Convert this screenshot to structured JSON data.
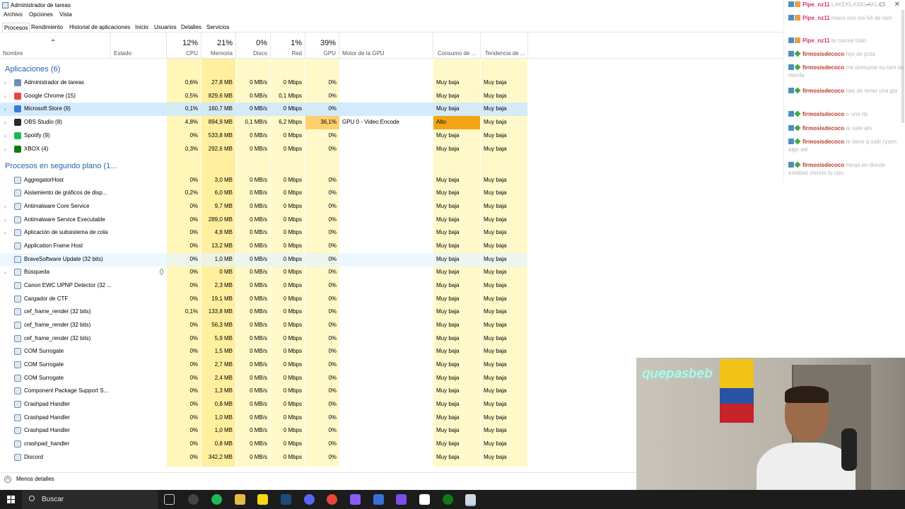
{
  "window": {
    "title": "Administrador de tareas"
  },
  "menu": [
    "Archivo",
    "Opciones",
    "Vista"
  ],
  "tabs": [
    "Procesos",
    "Rendimiento",
    "Historial de aplicaciones",
    "Inicio",
    "Usuarios",
    "Detalles",
    "Servicios"
  ],
  "columns": {
    "nombre": "Nombre",
    "estado": "Estado",
    "cpu_pct": "12%",
    "cpu": "CPU",
    "mem_pct": "21%",
    "mem": "Memoria",
    "disk_pct": "0%",
    "disk": "Disco",
    "net_pct": "1%",
    "net": "Red",
    "gpu_pct": "39%",
    "gpu": "GPU",
    "gpu_engine": "Motor de la GPU",
    "power": "Consumo de ...",
    "power_trend": "Tendencia de ..."
  },
  "groups": {
    "apps": "Aplicaciones (6)",
    "background": "Procesos en segundo plano (1..."
  },
  "apps": [
    {
      "name": "Administrador de tareas",
      "cpu": "0,6%",
      "mem": "27,8 MB",
      "disk": "0 MB/s",
      "net": "0 Mbps",
      "gpu": "0%",
      "engine": "",
      "power": "Muy baja",
      "trend": "Muy baja",
      "icon": "task-manager-icon",
      "color": "#6b8fb5"
    },
    {
      "name": "Google Chrome (15)",
      "cpu": "0,5%",
      "mem": "829,6 MB",
      "disk": "0 MB/s",
      "net": "0,1 Mbps",
      "gpu": "0%",
      "engine": "",
      "power": "Muy baja",
      "trend": "Muy baja",
      "icon": "chrome-icon",
      "color": "#e8453c"
    },
    {
      "name": "Microsoft Store (9)",
      "cpu": "0,1%",
      "mem": "160,7 MB",
      "disk": "0 MB/s",
      "net": "0 Mbps",
      "gpu": "0%",
      "engine": "",
      "power": "Muy baja",
      "trend": "Muy baja",
      "icon": "store-icon",
      "color": "#3a7bd5"
    },
    {
      "name": "OBS Studio (8)",
      "cpu": "4,8%",
      "mem": "894,9 MB",
      "disk": "0,1 MB/s",
      "net": "6,2 Mbps",
      "gpu": "36,1%",
      "engine": "GPU 0 - Video Encode",
      "power": "Alto",
      "trend": "Muy baja",
      "icon": "obs-icon",
      "color": "#2b2b2b"
    },
    {
      "name": "Spotify (9)",
      "cpu": "0%",
      "mem": "533,8 MB",
      "disk": "0 MB/s",
      "net": "0 Mbps",
      "gpu": "0%",
      "engine": "",
      "power": "Muy baja",
      "trend": "Muy baja",
      "icon": "spotify-icon",
      "color": "#1db954"
    },
    {
      "name": "XBOX (4)",
      "cpu": "0,3%",
      "mem": "292,6 MB",
      "disk": "0 MB/s",
      "net": "0 Mbps",
      "gpu": "0%",
      "engine": "",
      "power": "Muy baja",
      "trend": "Muy baja",
      "icon": "xbox-icon",
      "color": "#107c10"
    }
  ],
  "background": [
    {
      "name": "AggregatorHost",
      "cpu": "0%",
      "mem": "3,0 MB",
      "disk": "0 MB/s",
      "net": "0 Mbps",
      "gpu": "0%",
      "power": "Muy baja",
      "trend": "Muy baja",
      "icon": "process-icon"
    },
    {
      "name": "Aislamiento de gráficos de disp...",
      "cpu": "0,2%",
      "mem": "6,0 MB",
      "disk": "0 MB/s",
      "net": "0 Mbps",
      "gpu": "0%",
      "power": "Muy baja",
      "trend": "Muy baja",
      "icon": "process-icon"
    },
    {
      "name": "Antimalware Core Service",
      "cpu": "0%",
      "mem": "9,7 MB",
      "disk": "0 MB/s",
      "net": "0 Mbps",
      "gpu": "0%",
      "power": "Muy baja",
      "trend": "Muy baja",
      "icon": "process-icon"
    },
    {
      "name": "Antimalware Service Executable",
      "cpu": "0%",
      "mem": "289,0 MB",
      "disk": "0 MB/s",
      "net": "0 Mbps",
      "gpu": "0%",
      "power": "Muy baja",
      "trend": "Muy baja",
      "icon": "process-icon"
    },
    {
      "name": "Aplicación de subsistema de cola",
      "cpu": "0%",
      "mem": "4,8 MB",
      "disk": "0 MB/s",
      "net": "0 Mbps",
      "gpu": "0%",
      "power": "Muy baja",
      "trend": "Muy baja",
      "icon": "printer-icon"
    },
    {
      "name": "Application Frame Host",
      "cpu": "0%",
      "mem": "13,2 MB",
      "disk": "0 MB/s",
      "net": "0 Mbps",
      "gpu": "0%",
      "power": "Muy baja",
      "trend": "Muy baja",
      "icon": "process-icon"
    },
    {
      "name": "BraveSoftware Update (32 bits)",
      "cpu": "0%",
      "mem": "1,0 MB",
      "disk": "0 MB/s",
      "net": "0 Mbps",
      "gpu": "0%",
      "power": "Muy baja",
      "trend": "Muy baja",
      "icon": "process-icon"
    },
    {
      "name": "Búsqueda",
      "cpu": "0%",
      "mem": "0 MB",
      "disk": "0 MB/s",
      "net": "0 Mbps",
      "gpu": "0%",
      "power": "Muy baja",
      "trend": "Muy baja",
      "icon": "search-app-icon"
    },
    {
      "name": "Canon EWC UPNP Detector (32 ...",
      "cpu": "0%",
      "mem": "2,3 MB",
      "disk": "0 MB/s",
      "net": "0 Mbps",
      "gpu": "0%",
      "power": "Muy baja",
      "trend": "Muy baja",
      "icon": "process-icon"
    },
    {
      "name": "Cargador de CTF",
      "cpu": "0%",
      "mem": "19,1 MB",
      "disk": "0 MB/s",
      "net": "0 Mbps",
      "gpu": "0%",
      "power": "Muy baja",
      "trend": "Muy baja",
      "icon": "ctf-icon"
    },
    {
      "name": "cef_frame_render (32 bits)",
      "cpu": "0,1%",
      "mem": "133,8 MB",
      "disk": "0 MB/s",
      "net": "0 Mbps",
      "gpu": "0%",
      "power": "Muy baja",
      "trend": "Muy baja",
      "icon": "process-icon"
    },
    {
      "name": "cef_frame_render (32 bits)",
      "cpu": "0%",
      "mem": "56,3 MB",
      "disk": "0 MB/s",
      "net": "0 Mbps",
      "gpu": "0%",
      "power": "Muy baja",
      "trend": "Muy baja",
      "icon": "process-icon"
    },
    {
      "name": "cef_frame_render (32 bits)",
      "cpu": "0%",
      "mem": "5,9 MB",
      "disk": "0 MB/s",
      "net": "0 Mbps",
      "gpu": "0%",
      "power": "Muy baja",
      "trend": "Muy baja",
      "icon": "process-icon"
    },
    {
      "name": "COM Surrogate",
      "cpu": "0%",
      "mem": "1,5 MB",
      "disk": "0 MB/s",
      "net": "0 Mbps",
      "gpu": "0%",
      "power": "Muy baja",
      "trend": "Muy baja",
      "icon": "process-icon"
    },
    {
      "name": "COM Surrogate",
      "cpu": "0%",
      "mem": "2,7 MB",
      "disk": "0 MB/s",
      "net": "0 Mbps",
      "gpu": "0%",
      "power": "Muy baja",
      "trend": "Muy baja",
      "icon": "process-icon"
    },
    {
      "name": "COM Surrogate",
      "cpu": "0%",
      "mem": "2,4 MB",
      "disk": "0 MB/s",
      "net": "0 Mbps",
      "gpu": "0%",
      "power": "Muy baja",
      "trend": "Muy baja",
      "icon": "process-icon"
    },
    {
      "name": "Component Package Support S...",
      "cpu": "0%",
      "mem": "1,3 MB",
      "disk": "0 MB/s",
      "net": "0 Mbps",
      "gpu": "0%",
      "power": "Muy baja",
      "trend": "Muy baja",
      "icon": "process-icon"
    },
    {
      "name": "Crashpad Handler",
      "cpu": "0%",
      "mem": "0,8 MB",
      "disk": "0 MB/s",
      "net": "0 Mbps",
      "gpu": "0%",
      "power": "Muy baja",
      "trend": "Muy baja",
      "icon": "process-icon"
    },
    {
      "name": "Crashpad Handler",
      "cpu": "0%",
      "mem": "1,0 MB",
      "disk": "0 MB/s",
      "net": "0 Mbps",
      "gpu": "0%",
      "power": "Muy baja",
      "trend": "Muy baja",
      "icon": "process-icon"
    },
    {
      "name": "Crashpad Handler",
      "cpu": "0%",
      "mem": "1,0 MB",
      "disk": "0 MB/s",
      "net": "0 Mbps",
      "gpu": "0%",
      "power": "Muy baja",
      "trend": "Muy baja",
      "icon": "process-icon"
    },
    {
      "name": "crashpad_handler",
      "cpu": "0%",
      "mem": "0,8 MB",
      "disk": "0 MB/s",
      "net": "0 Mbps",
      "gpu": "0%",
      "power": "Muy baja",
      "trend": "Muy baja",
      "icon": "process-icon"
    },
    {
      "name": "Discord",
      "cpu": "0%",
      "mem": "342,2 MB",
      "disk": "0 MB/s",
      "net": "0 Mbps",
      "gpu": "0%",
      "power": "Muy baja",
      "trend": "Muy baja",
      "icon": "discord-icon"
    }
  ],
  "bottom": {
    "fewer_details": "Menos detalles"
  },
  "chat": [
    {
      "user": "Pipe_nz11",
      "text": "LAKEKLASKLAKLAS"
    },
    {
      "user": "Pipe_nz11",
      "text": "mano con los 64 de ram"
    },
    {
      "user": "Pipe_nz11",
      "text": "te carrea todo"
    },
    {
      "user": "firmosisdecoco",
      "text": "hijo de puta"
    },
    {
      "user": "firmosisdecoco",
      "text": "me presume su ram de merda"
    },
    {
      "user": "firmosisdecoco",
      "text": "has de tener una gtx"
    },
    {
      "user": "firmosisdecoco",
      "text": "o una rtx"
    },
    {
      "user": "firmosisdecoco",
      "text": "te sale ahi"
    },
    {
      "user": "firmosisdecoco",
      "text": "te tiene q salir ryzen algo asi"
    },
    {
      "user": "firmosisdecoco",
      "text": "mirqa en donde estabas viendo tu cpu"
    }
  ],
  "webcam": {
    "neon_text": "quepasbeb"
  },
  "taskbar": {
    "search_label": "Buscar"
  },
  "colors": {
    "heat_light": "#fff9c9",
    "heat_mid": "#fff4b3",
    "heat_high": "#ffd279",
    "alto": "#f2a515",
    "group_blue": "#2a62a8"
  }
}
